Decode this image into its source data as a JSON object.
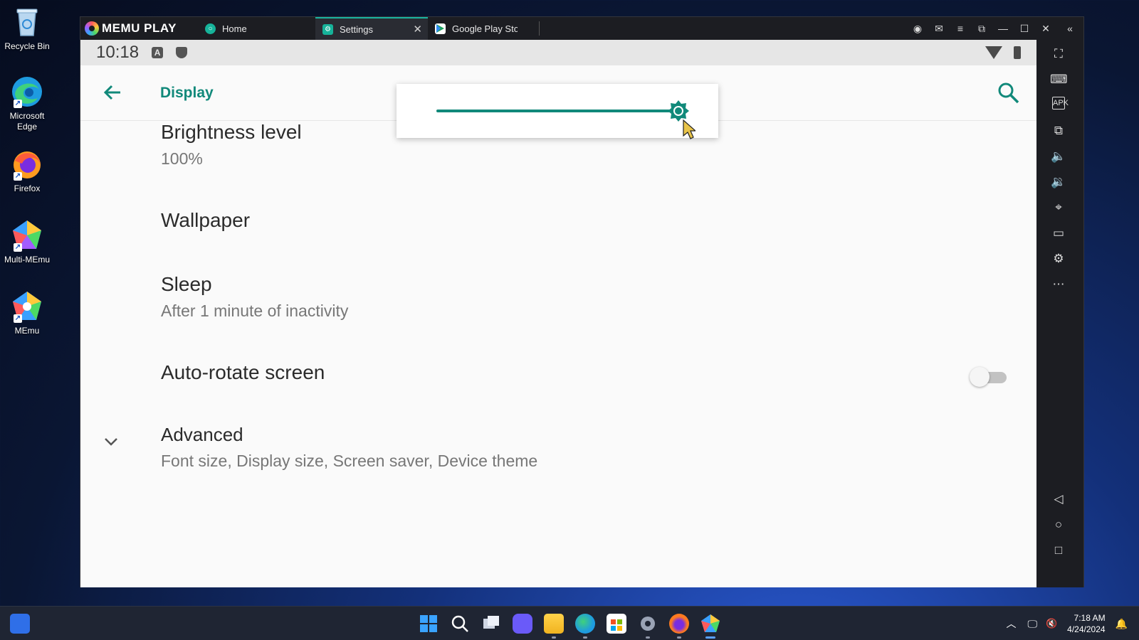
{
  "desktop": {
    "icons": [
      {
        "label": "Recycle Bin",
        "icon": "recycle-bin-icon"
      },
      {
        "label": "Microsoft\nEdge",
        "icon": "edge-icon"
      },
      {
        "label": "Firefox",
        "icon": "firefox-icon"
      },
      {
        "label": "Multi-MEmu",
        "icon": "multi-memu-icon"
      },
      {
        "label": "MEmu",
        "icon": "memu-icon"
      }
    ]
  },
  "memu": {
    "brand": "MEMU PLAY",
    "tabs": [
      {
        "label": "Home",
        "icon": "home-tab-icon"
      },
      {
        "label": "Settings",
        "icon": "settings-tab-icon"
      },
      {
        "label": "Google Play Store",
        "icon": "play-store-icon"
      }
    ],
    "accent": "#11897a"
  },
  "android": {
    "status": {
      "time": "10:18"
    },
    "appbar": {
      "title": "Display"
    },
    "brightness_slider": {
      "value_fraction": 1.0
    },
    "items": [
      {
        "title": "Brightness level",
        "subtitle": "100%"
      },
      {
        "title": "Wallpaper",
        "subtitle": ""
      },
      {
        "title": "Sleep",
        "subtitle": "After 1 minute of inactivity"
      },
      {
        "title": "Auto-rotate screen",
        "subtitle": "",
        "toggle": false
      },
      {
        "title": "Advanced",
        "subtitle": "Font size, Display size, Screen saver, Device theme"
      }
    ]
  },
  "taskbar": {
    "time": "7:18 AM",
    "date": "4/24/2024"
  }
}
